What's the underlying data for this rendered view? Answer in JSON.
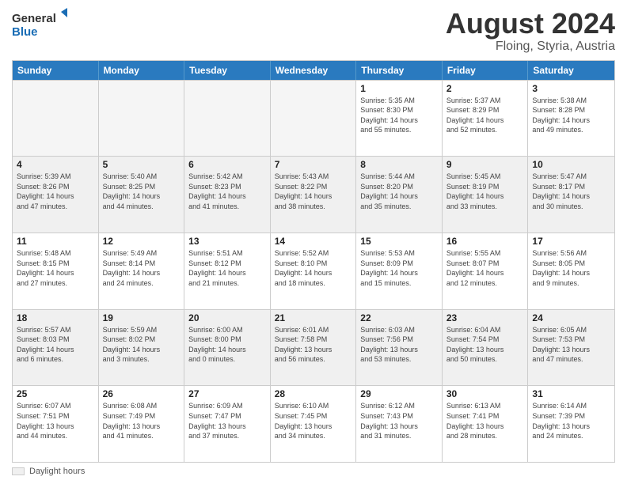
{
  "logo": {
    "line1": "General",
    "line2": "Blue"
  },
  "title": "August 2024",
  "subtitle": "Floing, Styria, Austria",
  "header_days": [
    "Sunday",
    "Monday",
    "Tuesday",
    "Wednesday",
    "Thursday",
    "Friday",
    "Saturday"
  ],
  "weeks": [
    [
      {
        "day": "",
        "info": "",
        "empty": true
      },
      {
        "day": "",
        "info": "",
        "empty": true
      },
      {
        "day": "",
        "info": "",
        "empty": true
      },
      {
        "day": "",
        "info": "",
        "empty": true
      },
      {
        "day": "1",
        "info": "Sunrise: 5:35 AM\nSunset: 8:30 PM\nDaylight: 14 hours\nand 55 minutes."
      },
      {
        "day": "2",
        "info": "Sunrise: 5:37 AM\nSunset: 8:29 PM\nDaylight: 14 hours\nand 52 minutes."
      },
      {
        "day": "3",
        "info": "Sunrise: 5:38 AM\nSunset: 8:28 PM\nDaylight: 14 hours\nand 49 minutes."
      }
    ],
    [
      {
        "day": "4",
        "info": "Sunrise: 5:39 AM\nSunset: 8:26 PM\nDaylight: 14 hours\nand 47 minutes."
      },
      {
        "day": "5",
        "info": "Sunrise: 5:40 AM\nSunset: 8:25 PM\nDaylight: 14 hours\nand 44 minutes."
      },
      {
        "day": "6",
        "info": "Sunrise: 5:42 AM\nSunset: 8:23 PM\nDaylight: 14 hours\nand 41 minutes."
      },
      {
        "day": "7",
        "info": "Sunrise: 5:43 AM\nSunset: 8:22 PM\nDaylight: 14 hours\nand 38 minutes."
      },
      {
        "day": "8",
        "info": "Sunrise: 5:44 AM\nSunset: 8:20 PM\nDaylight: 14 hours\nand 35 minutes."
      },
      {
        "day": "9",
        "info": "Sunrise: 5:45 AM\nSunset: 8:19 PM\nDaylight: 14 hours\nand 33 minutes."
      },
      {
        "day": "10",
        "info": "Sunrise: 5:47 AM\nSunset: 8:17 PM\nDaylight: 14 hours\nand 30 minutes."
      }
    ],
    [
      {
        "day": "11",
        "info": "Sunrise: 5:48 AM\nSunset: 8:15 PM\nDaylight: 14 hours\nand 27 minutes."
      },
      {
        "day": "12",
        "info": "Sunrise: 5:49 AM\nSunset: 8:14 PM\nDaylight: 14 hours\nand 24 minutes."
      },
      {
        "day": "13",
        "info": "Sunrise: 5:51 AM\nSunset: 8:12 PM\nDaylight: 14 hours\nand 21 minutes."
      },
      {
        "day": "14",
        "info": "Sunrise: 5:52 AM\nSunset: 8:10 PM\nDaylight: 14 hours\nand 18 minutes."
      },
      {
        "day": "15",
        "info": "Sunrise: 5:53 AM\nSunset: 8:09 PM\nDaylight: 14 hours\nand 15 minutes."
      },
      {
        "day": "16",
        "info": "Sunrise: 5:55 AM\nSunset: 8:07 PM\nDaylight: 14 hours\nand 12 minutes."
      },
      {
        "day": "17",
        "info": "Sunrise: 5:56 AM\nSunset: 8:05 PM\nDaylight: 14 hours\nand 9 minutes."
      }
    ],
    [
      {
        "day": "18",
        "info": "Sunrise: 5:57 AM\nSunset: 8:03 PM\nDaylight: 14 hours\nand 6 minutes."
      },
      {
        "day": "19",
        "info": "Sunrise: 5:59 AM\nSunset: 8:02 PM\nDaylight: 14 hours\nand 3 minutes."
      },
      {
        "day": "20",
        "info": "Sunrise: 6:00 AM\nSunset: 8:00 PM\nDaylight: 14 hours\nand 0 minutes."
      },
      {
        "day": "21",
        "info": "Sunrise: 6:01 AM\nSunset: 7:58 PM\nDaylight: 13 hours\nand 56 minutes."
      },
      {
        "day": "22",
        "info": "Sunrise: 6:03 AM\nSunset: 7:56 PM\nDaylight: 13 hours\nand 53 minutes."
      },
      {
        "day": "23",
        "info": "Sunrise: 6:04 AM\nSunset: 7:54 PM\nDaylight: 13 hours\nand 50 minutes."
      },
      {
        "day": "24",
        "info": "Sunrise: 6:05 AM\nSunset: 7:53 PM\nDaylight: 13 hours\nand 47 minutes."
      }
    ],
    [
      {
        "day": "25",
        "info": "Sunrise: 6:07 AM\nSunset: 7:51 PM\nDaylight: 13 hours\nand 44 minutes."
      },
      {
        "day": "26",
        "info": "Sunrise: 6:08 AM\nSunset: 7:49 PM\nDaylight: 13 hours\nand 41 minutes."
      },
      {
        "day": "27",
        "info": "Sunrise: 6:09 AM\nSunset: 7:47 PM\nDaylight: 13 hours\nand 37 minutes."
      },
      {
        "day": "28",
        "info": "Sunrise: 6:10 AM\nSunset: 7:45 PM\nDaylight: 13 hours\nand 34 minutes."
      },
      {
        "day": "29",
        "info": "Sunrise: 6:12 AM\nSunset: 7:43 PM\nDaylight: 13 hours\nand 31 minutes."
      },
      {
        "day": "30",
        "info": "Sunrise: 6:13 AM\nSunset: 7:41 PM\nDaylight: 13 hours\nand 28 minutes."
      },
      {
        "day": "31",
        "info": "Sunrise: 6:14 AM\nSunset: 7:39 PM\nDaylight: 13 hours\nand 24 minutes."
      }
    ]
  ],
  "legend": {
    "box_label": "Daylight hours"
  }
}
